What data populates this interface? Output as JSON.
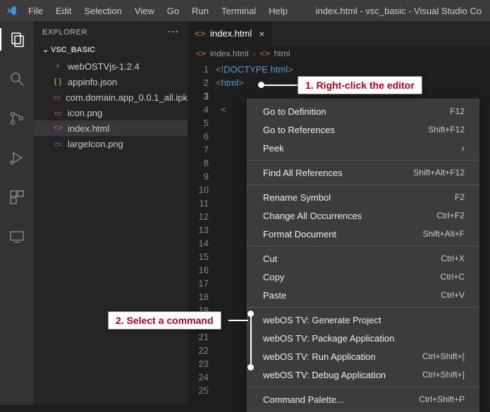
{
  "titlebar": {
    "menus": [
      "File",
      "Edit",
      "Selection",
      "View",
      "Go",
      "Run",
      "Terminal",
      "Help"
    ],
    "title": "index.html - vsc_basic - Visual Studio Co"
  },
  "sidebar": {
    "header": "EXPLORER",
    "section": "VSC_BASIC",
    "items": [
      {
        "label": "webOSTVjs-1.2.4",
        "icon": "chevron-right-icon",
        "cls": "ic-folder",
        "depth": 2,
        "selected": false
      },
      {
        "label": "appinfo.json",
        "icon": "braces-icon",
        "cls": "ic-json",
        "glyph": "{ }",
        "depth": 2,
        "selected": false
      },
      {
        "label": "com.domain.app_0.0.1_all.ipk",
        "icon": "package-icon",
        "cls": "ic-pkg",
        "glyph": "▭",
        "depth": 2,
        "selected": false
      },
      {
        "label": "icon.png",
        "icon": "image-icon",
        "cls": "ic-img",
        "glyph": "▭",
        "depth": 2,
        "selected": false
      },
      {
        "label": "index.html",
        "icon": "html-icon",
        "cls": "ic-html",
        "glyph": "<>",
        "depth": 2,
        "selected": true
      },
      {
        "label": "largeIcon.png",
        "icon": "image-icon",
        "cls": "ic-img",
        "glyph": "▭",
        "depth": 2,
        "selected": false
      }
    ]
  },
  "tab": {
    "label": "index.html"
  },
  "breadcrumb": {
    "file": "index.html",
    "node": "html"
  },
  "code": {
    "lines_total": 25,
    "current_line": 3,
    "line1_pre": "<!",
    "line1_kw": "DOCTYPE ",
    "line1_tag": "html",
    "line1_post": ">",
    "line2_pre": "<",
    "line2_tag": "html",
    "line2_post": ">",
    "line4": "  <"
  },
  "context_menu": [
    {
      "type": "item",
      "label": "Go to Definition",
      "kb": "F12"
    },
    {
      "type": "item",
      "label": "Go to References",
      "kb": "Shift+F12"
    },
    {
      "type": "item",
      "label": "Peek",
      "sub": true
    },
    {
      "type": "sep"
    },
    {
      "type": "item",
      "label": "Find All References",
      "kb": "Shift+Alt+F12"
    },
    {
      "type": "sep"
    },
    {
      "type": "item",
      "label": "Rename Symbol",
      "kb": "F2"
    },
    {
      "type": "item",
      "label": "Change All Occurrences",
      "kb": "Ctrl+F2"
    },
    {
      "type": "item",
      "label": "Format Document",
      "kb": "Shift+Alt+F"
    },
    {
      "type": "sep"
    },
    {
      "type": "item",
      "label": "Cut",
      "kb": "Ctrl+X"
    },
    {
      "type": "item",
      "label": "Copy",
      "kb": "Ctrl+C"
    },
    {
      "type": "item",
      "label": "Paste",
      "kb": "Ctrl+V"
    },
    {
      "type": "sep"
    },
    {
      "type": "item",
      "label": "webOS TV: Generate Project",
      "kb": ""
    },
    {
      "type": "item",
      "label": "webOS TV: Package Application",
      "kb": ""
    },
    {
      "type": "item",
      "label": "webOS TV: Run Application",
      "kb": "Ctrl+Shift+["
    },
    {
      "type": "item",
      "label": "webOS TV: Debug Application",
      "kb": "Ctrl+Shift+]"
    },
    {
      "type": "sep"
    },
    {
      "type": "item",
      "label": "Command Palette...",
      "kb": "Ctrl+Shift+P"
    }
  ],
  "callouts": {
    "c1": "1. Right-click the editor",
    "c2": "2. Select a command"
  }
}
